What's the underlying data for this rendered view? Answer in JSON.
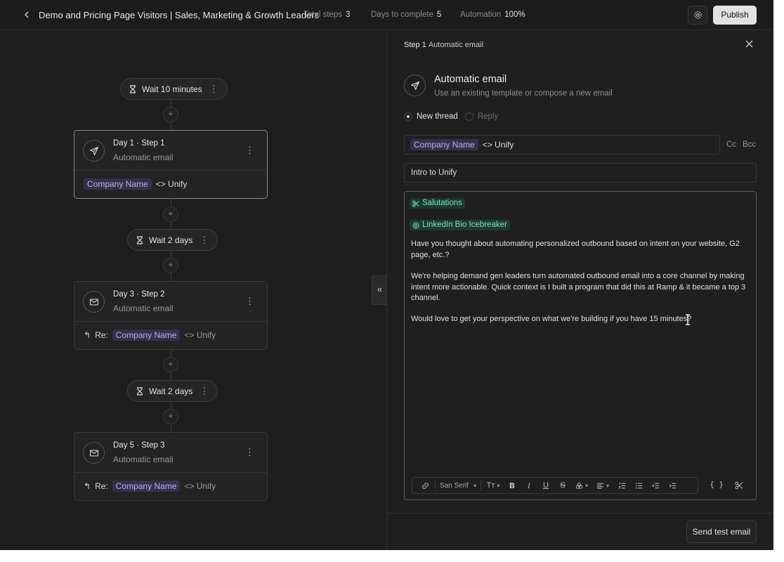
{
  "header": {
    "title": "Demo and Pricing Page Visitors | Sales, Marketing & Growth Leaders",
    "total_steps_label": "Total steps",
    "total_steps_value": "3",
    "days_label": "Days to complete",
    "days_value": "5",
    "automation_label": "Automation",
    "automation_value": "100%",
    "publish_label": "Publish"
  },
  "canvas": {
    "waits": [
      {
        "label": "Wait 10 minutes"
      },
      {
        "label": "Wait 2 days"
      },
      {
        "label": "Wait 2 days"
      }
    ],
    "steps": [
      {
        "title": "Day 1 · Step 1",
        "subtitle": "Automatic email",
        "prefix": "",
        "variable": "Company Name",
        "suffix": "<> Unify"
      },
      {
        "title": "Day 3 · Step 2",
        "subtitle": "Automatic email",
        "prefix": "Re:",
        "variable": "Company Name",
        "suffix": "<> Unify"
      },
      {
        "title": "Day 5 · Step 3",
        "subtitle": "Automatic email",
        "prefix": "Re:",
        "variable": "Company Name",
        "suffix": "<> Unify"
      }
    ],
    "plus": "+",
    "collapse": "«"
  },
  "panel": {
    "step_label": "Step 1",
    "step_type": "Automatic email",
    "title": "Automatic email",
    "description": "Use an existing template or compose a new email",
    "radio_new": "New thread",
    "radio_reply": "Reply",
    "to_variable": "Company Name",
    "to_suffix": "<> Unify",
    "cc": "Cc",
    "bcc": "Bcc",
    "subject": "Intro to Unify",
    "snippets": [
      "Salutations",
      "LinkedIn Bio Icebreaker"
    ],
    "body": [
      "Have you thought about automating personalized outbound based on intent on your website, G2 page, etc.?",
      "We're helping demand gen leaders turn automated outbound email into a core channel by making intent more actionable. Quick context is I built a program that did this at Ramp & it became a top 3 channel.",
      "Would love to get your perspective on what we're building if you have 15 minutes?"
    ],
    "toolbar": {
      "font": "San Serif",
      "text_size": "Tт",
      "bold": "B",
      "italic": "i",
      "underline": "U",
      "strike": "S",
      "braces": "{ }"
    },
    "send_test": "Send test email"
  }
}
